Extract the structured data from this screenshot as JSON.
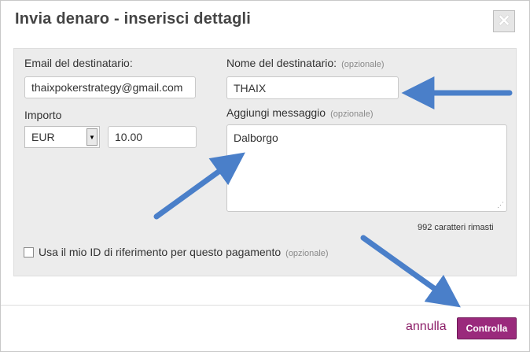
{
  "dialog": {
    "title": "Invia denaro - inserisci dettagli",
    "close_glyph": "✕",
    "close_icon": "close-icon"
  },
  "form": {
    "email_label": "Email del destinatario:",
    "email_value": "thaixpokerstrategy@gmail.com",
    "name_label": "Nome del destinatario:",
    "name_optional": "(opzionale)",
    "name_value": "THAIX",
    "amount_label": "Importo",
    "currency_value": "EUR",
    "amount_value": "10.00",
    "message_label": "Aggiungi messaggio",
    "message_optional": "(opzionale)",
    "message_value": "Dalborgo",
    "chars_remaining": "992 caratteri rimasti",
    "checkbox_label": "Usa il mio ID di riferimento per questo pagamento",
    "checkbox_optional": "(opzionale)"
  },
  "footer": {
    "cancel_label": "annulla",
    "submit_label": "Controlla"
  },
  "colors": {
    "accent": "#9a2a7c",
    "link": "#8c1e68",
    "arrow": "#4a7fc9"
  }
}
